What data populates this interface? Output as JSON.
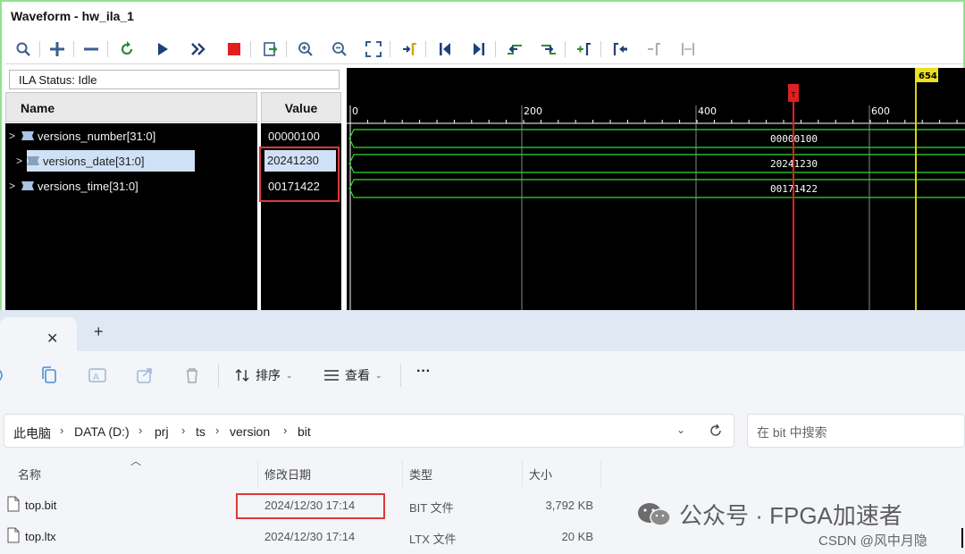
{
  "waveform": {
    "title": "Waveform - hw_ila_1",
    "ila_status": "ILA Status: Idle",
    "name_header": "Name",
    "value_header": "Value",
    "signals": [
      {
        "name": "versions_number[31:0]",
        "value": "00000100",
        "wave_value": "00000100"
      },
      {
        "name": "versions_date[31:0]",
        "value": "20241230",
        "wave_value": "20241230"
      },
      {
        "name": "versions_time[31:0]",
        "value": "00171422",
        "wave_value": "00171422"
      }
    ],
    "timeline_ticks": [
      "0",
      "200",
      "400",
      "600"
    ],
    "trigger_marker": "T",
    "cursor_label": "654",
    "toolbar_icons": [
      "zoom-search-icon",
      "add-icon",
      "remove-icon",
      "refresh-icon",
      "run-icon",
      "run-immediate-icon",
      "stop-icon",
      "export-icon",
      "zoom-in-icon",
      "zoom-out-icon",
      "zoom-fit-icon",
      "goto-cursor-icon",
      "goto-start-icon",
      "goto-end-icon",
      "prev-transition-icon",
      "next-transition-icon",
      "add-marker-icon",
      "prev-marker-icon",
      "next-marker-icon",
      "swap-cursors-icon"
    ]
  },
  "explorer": {
    "toolbar": {
      "sort_label": "排序",
      "view_label": "查看",
      "more_label": "···"
    },
    "breadcrumb": [
      "此电脑",
      "DATA (D:)",
      "prj",
      "ts",
      "version",
      "bit"
    ],
    "search_placeholder": "在 bit 中搜索",
    "columns": [
      "名称",
      "修改日期",
      "类型",
      "大小"
    ],
    "files": [
      {
        "name": "top.bit",
        "modified": "2024/12/30 17:14",
        "type": "BIT 文件",
        "size": "3,792 KB"
      },
      {
        "name": "top.ltx",
        "modified": "2024/12/30 17:14",
        "type": "LTX 文件",
        "size": "20 KB"
      }
    ]
  },
  "watermark": {
    "text": "公众号 · FPGA加速者",
    "csdn": "CSDN @风中月隐"
  },
  "colors": {
    "wave_green": "#2fdc2f",
    "trigger_red": "#e02020",
    "cursor_yellow": "#d8d20a",
    "highlight_red": "#d93a3a"
  }
}
